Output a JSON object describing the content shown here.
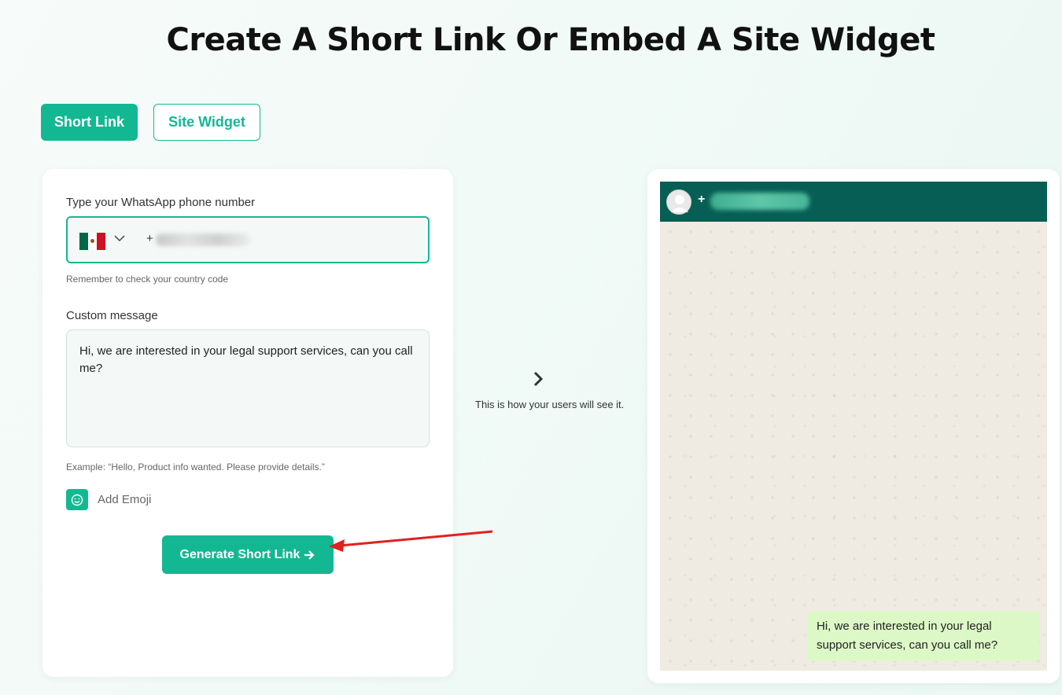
{
  "page": {
    "title": "Create A Short Link Or Embed A Site Widget"
  },
  "tabs": [
    {
      "label": "Short Link"
    },
    {
      "label": "Site Widget"
    }
  ],
  "form": {
    "phone_label": "Type your WhatsApp phone number",
    "phone_value": "+",
    "country": "Mexico",
    "phone_hint": "Remember to check your country code",
    "message_label": "Custom message",
    "message_value": "Hi, we are interested in your legal support services, can you call me?",
    "message_example": "Example: “Hello, Product info wanted. Please provide details.”",
    "emoji_label": "Add Emoji",
    "generate_label": "Generate Short Link"
  },
  "preview": {
    "note": "This is how your users will see it.",
    "contact_prefix": "+",
    "bubble_text": "Hi, we are interested in your legal support services, can you call me?"
  },
  "colors": {
    "accent": "#13b892",
    "whatsapp_header": "#075e54",
    "bubble": "#dcf8c6",
    "annotation_arrow": "#e02020"
  }
}
